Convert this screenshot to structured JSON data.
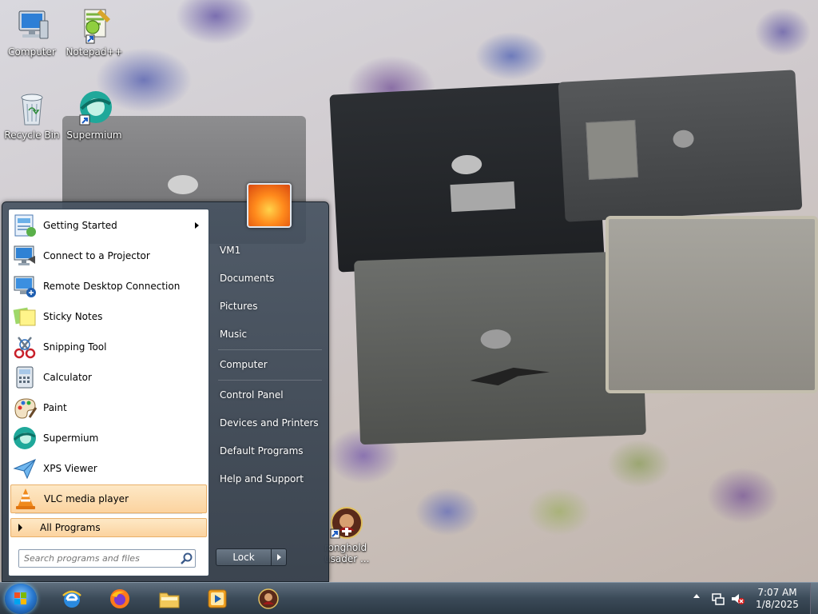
{
  "desktop": {
    "icons": [
      {
        "label": "Computer",
        "icon": "computer-icon"
      },
      {
        "label": "Notepad++",
        "icon": "notepadpp-icon"
      },
      {
        "label": "Recycle Bin",
        "icon": "recycle-bin-icon"
      },
      {
        "label": "Supermium",
        "icon": "supermium-icon"
      },
      {
        "label": "ronghold\nusader ...",
        "line1": "ronghold",
        "line2": "usader ...",
        "icon": "stronghold-crusader-icon"
      }
    ]
  },
  "start_menu": {
    "pinned": [
      {
        "label": "Getting Started",
        "has_submenu": true,
        "icon": "getting-started-icon"
      },
      {
        "label": "Connect to a Projector",
        "icon": "projector-icon"
      },
      {
        "label": "Remote Desktop Connection",
        "icon": "remote-desktop-icon"
      },
      {
        "label": "Sticky Notes",
        "icon": "sticky-notes-icon"
      },
      {
        "label": "Snipping Tool",
        "icon": "snipping-tool-icon"
      },
      {
        "label": "Calculator",
        "icon": "calculator-icon"
      },
      {
        "label": "Paint",
        "icon": "paint-icon"
      },
      {
        "label": "Supermium",
        "icon": "supermium-icon"
      },
      {
        "label": "XPS Viewer",
        "icon": "xps-viewer-icon"
      },
      {
        "label": "VLC media player",
        "icon": "vlc-icon",
        "highlighted": true
      }
    ],
    "all_programs": "All Programs",
    "search_placeholder": "Search programs and files",
    "right": [
      {
        "label": "VM1"
      },
      {
        "label": "Documents"
      },
      {
        "label": "Pictures"
      },
      {
        "label": "Music"
      },
      {
        "label": "Computer"
      },
      {
        "label": "Control Panel"
      },
      {
        "label": "Devices and Printers"
      },
      {
        "label": "Default Programs"
      },
      {
        "label": "Help and Support"
      }
    ],
    "lock_label": "Lock"
  },
  "taskbar": {
    "pinned": [
      "internet-explorer-icon",
      "firefox-icon",
      "file-explorer-icon",
      "media-player-icon",
      "stronghold-crusader-icon"
    ],
    "clock_time": "7:07 AM",
    "clock_date": "1/8/2025"
  },
  "colors": {
    "highlight": "#fcd39f",
    "start_menu_bg": "#46525f",
    "taskbar": "#3b4a58"
  }
}
